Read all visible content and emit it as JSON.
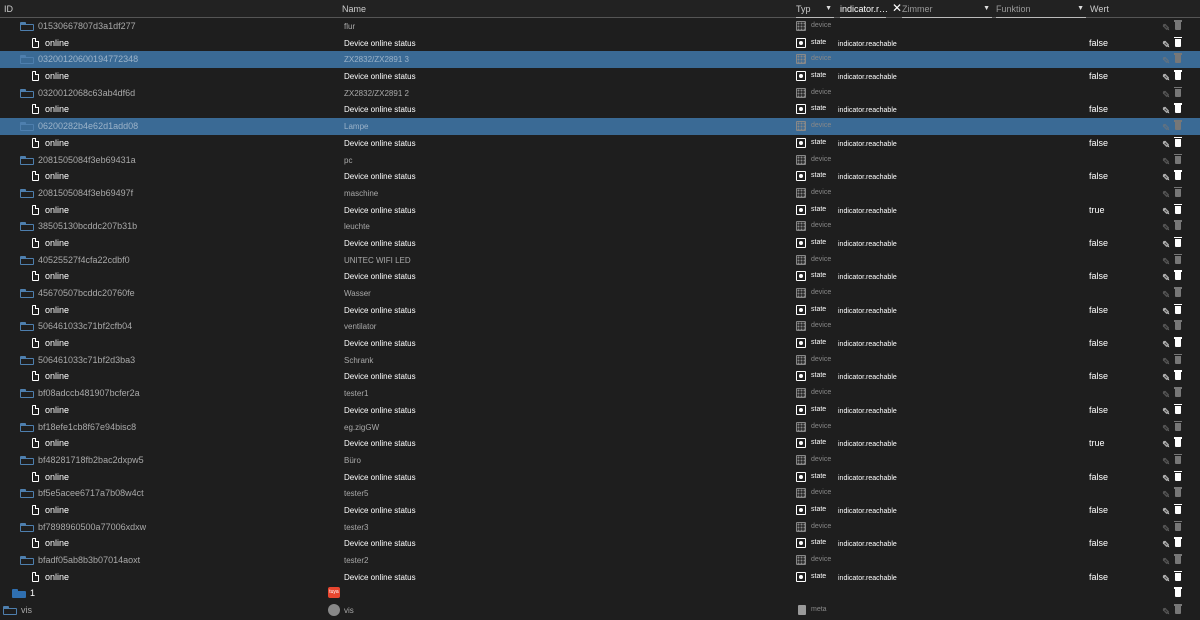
{
  "header": {
    "id": "ID",
    "name": "Name",
    "typ": "Typ",
    "role_filter": "indicator.r…",
    "zimmer": "Zimmer",
    "funktion": "Funktion",
    "wert": "Wert"
  },
  "icons": {
    "folder": "folder-icon",
    "state": "document-icon",
    "edit": "pencil-icon",
    "delete": "trash-icon",
    "clear": "close-icon"
  },
  "rows": [
    {
      "kind": "folder",
      "id": "01530667807d3a1df277",
      "name": "flur",
      "typ": "device",
      "sel": false
    },
    {
      "kind": "state",
      "id": "online",
      "name": "Device online status",
      "typ": "state",
      "role": "indicator.reachable",
      "value": "false"
    },
    {
      "kind": "folder",
      "id": "03200120600194772348",
      "name": "ZX2832/ZX2891 3",
      "typ": "device",
      "sel": true
    },
    {
      "kind": "state",
      "id": "online",
      "name": "Device online status",
      "typ": "state",
      "role": "indicator.reachable",
      "value": "false"
    },
    {
      "kind": "folder",
      "id": "0320012068c63ab4df6d",
      "name": "ZX2832/ZX2891 2",
      "typ": "device",
      "sel": false
    },
    {
      "kind": "state",
      "id": "online",
      "name": "Device online status",
      "typ": "state",
      "role": "indicator.reachable",
      "value": "false"
    },
    {
      "kind": "folder",
      "id": "06200282b4e62d1add08",
      "name": "Lampe",
      "typ": "device",
      "sel": true
    },
    {
      "kind": "state",
      "id": "online",
      "name": "Device online status",
      "typ": "state",
      "role": "indicator.reachable",
      "value": "false"
    },
    {
      "kind": "folder",
      "id": "2081505084f3eb69431a",
      "name": "pc",
      "typ": "device",
      "sel": false
    },
    {
      "kind": "state",
      "id": "online",
      "name": "Device online status",
      "typ": "state",
      "role": "indicator.reachable",
      "value": "false"
    },
    {
      "kind": "folder",
      "id": "2081505084f3eb69497f",
      "name": "maschine",
      "typ": "device",
      "sel": false
    },
    {
      "kind": "state",
      "id": "online",
      "name": "Device online status",
      "typ": "state",
      "role": "indicator.reachable",
      "value": "true"
    },
    {
      "kind": "folder",
      "id": "38505130bcddc207b31b",
      "name": "leuchte",
      "typ": "device",
      "sel": false
    },
    {
      "kind": "state",
      "id": "online",
      "name": "Device online status",
      "typ": "state",
      "role": "indicator.reachable",
      "value": "false"
    },
    {
      "kind": "folder",
      "id": "40525527f4cfa22cdbf0",
      "name": "UNITEC WIFI LED",
      "typ": "device",
      "sel": false
    },
    {
      "kind": "state",
      "id": "online",
      "name": "Device online status",
      "typ": "state",
      "role": "indicator.reachable",
      "value": "false"
    },
    {
      "kind": "folder",
      "id": "45670507bcddc20760fe",
      "name": "Wasser",
      "typ": "device",
      "sel": false
    },
    {
      "kind": "state",
      "id": "online",
      "name": "Device online status",
      "typ": "state",
      "role": "indicator.reachable",
      "value": "false"
    },
    {
      "kind": "folder",
      "id": "506461033c71bf2cfb04",
      "name": "ventilator",
      "typ": "device",
      "sel": false
    },
    {
      "kind": "state",
      "id": "online",
      "name": "Device online status",
      "typ": "state",
      "role": "indicator.reachable",
      "value": "false"
    },
    {
      "kind": "folder",
      "id": "506461033c71bf2d3ba3",
      "name": "Schrank",
      "typ": "device",
      "sel": false
    },
    {
      "kind": "state",
      "id": "online",
      "name": "Device online status",
      "typ": "state",
      "role": "indicator.reachable",
      "value": "false"
    },
    {
      "kind": "folder",
      "id": "bf08adccb481907bcfer2a",
      "name": "tester1",
      "typ": "device",
      "sel": false
    },
    {
      "kind": "state",
      "id": "online",
      "name": "Device online status",
      "typ": "state",
      "role": "indicator.reachable",
      "value": "false"
    },
    {
      "kind": "folder",
      "id": "bf18efe1cb8f67e94bisc8",
      "name": "eg.zigGW",
      "typ": "device",
      "sel": false
    },
    {
      "kind": "state",
      "id": "online",
      "name": "Device online status",
      "typ": "state",
      "role": "indicator.reachable",
      "value": "true"
    },
    {
      "kind": "folder",
      "id": "bf48281718fb2bac2dxpw5",
      "name": "Büro",
      "typ": "device",
      "sel": false
    },
    {
      "kind": "state",
      "id": "online",
      "name": "Device online status",
      "typ": "state",
      "role": "indicator.reachable",
      "value": "false"
    },
    {
      "kind": "folder",
      "id": "bf5e5acee6717a7b08w4ct",
      "name": "tester5",
      "typ": "device",
      "sel": false
    },
    {
      "kind": "state",
      "id": "online",
      "name": "Device online status",
      "typ": "state",
      "role": "indicator.reachable",
      "value": "false"
    },
    {
      "kind": "folder",
      "id": "bf7898960500a77006xdxw",
      "name": "tester3",
      "typ": "device",
      "sel": false
    },
    {
      "kind": "state",
      "id": "online",
      "name": "Device online status",
      "typ": "state",
      "role": "indicator.reachable",
      "value": "false"
    },
    {
      "kind": "folder",
      "id": "bfadf05ab8b3b07014aoxt",
      "name": "tester2",
      "typ": "device",
      "sel": false
    },
    {
      "kind": "state",
      "id": "online",
      "name": "Device online status",
      "typ": "state",
      "role": "indicator.reachable",
      "value": "false"
    },
    {
      "kind": "root",
      "id": "1",
      "badge": "tuya",
      "name": "",
      "typ": ""
    },
    {
      "kind": "root2",
      "id": "vis",
      "name": "vis",
      "typ": "meta"
    }
  ]
}
